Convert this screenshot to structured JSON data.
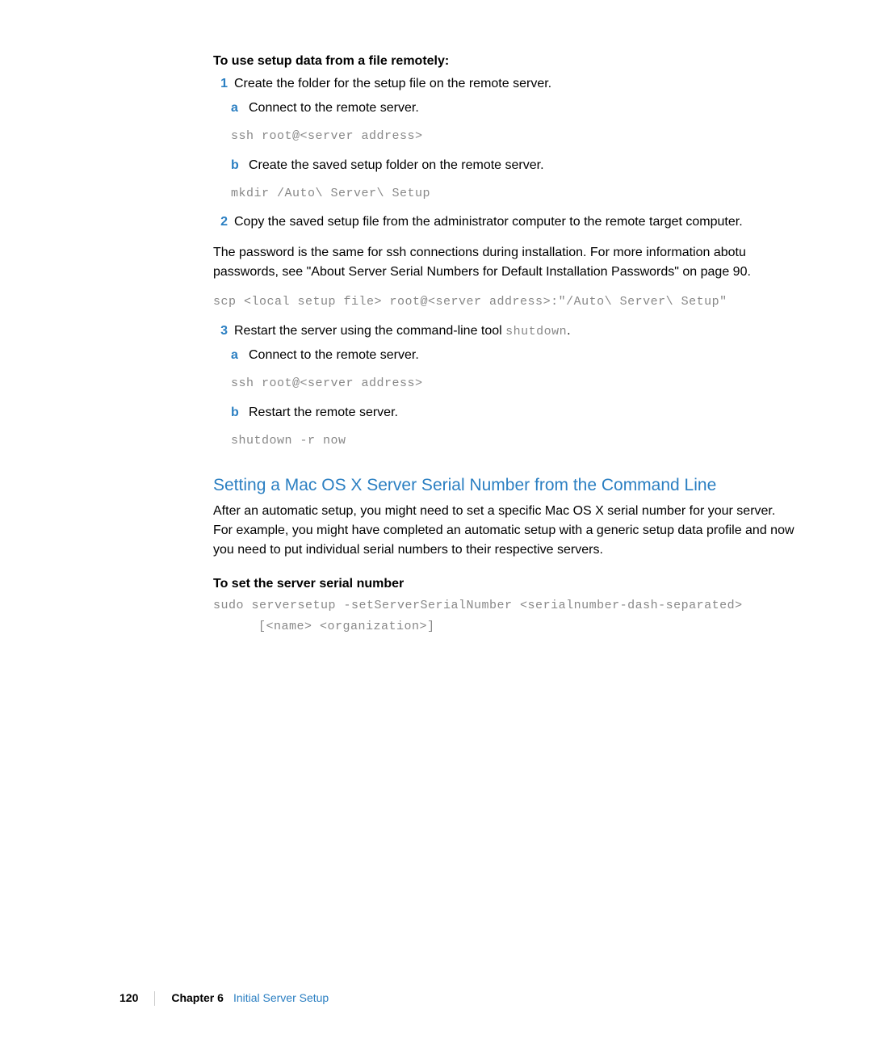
{
  "headings": {
    "remote_setup": "To use setup data from a file remotely:",
    "serial_section": "Setting a Mac OS X Server Serial Number from the Command Line",
    "serial_subheading": "To set the server serial number"
  },
  "steps": {
    "s1": {
      "num": "1",
      "text": "Create the folder for the setup file on the remote server.",
      "a": {
        "letter": "a",
        "text": "Connect to the remote server."
      },
      "a_code": "ssh root@<server address>",
      "b": {
        "letter": "b",
        "text": "Create the saved setup folder on the remote server."
      },
      "b_code": "mkdir /Auto\\ Server\\ Setup"
    },
    "s2": {
      "num": "2",
      "text": "Copy the saved setup file from the administrator computer to the remote target computer.",
      "para": "The password is the same for ssh connections during installation. For more information abotu passwords, see \"About Server Serial Numbers for Default Installation Passwords\" on page 90.",
      "code": "scp <local setup file> root@<server address>:\"/Auto\\ Server\\ Setup\""
    },
    "s3": {
      "num": "3",
      "text_before": "Restart the server using the command-line tool ",
      "code_inline": "shutdown",
      "text_after": ".",
      "a": {
        "letter": "a",
        "text": "Connect to the remote server."
      },
      "a_code": "ssh root@<server address>",
      "b": {
        "letter": "b",
        "text": "Restart the remote server."
      },
      "b_code": "shutdown -r now"
    }
  },
  "serial_section": {
    "para": "After an automatic setup, you might need to set a specific Mac OS X serial number for your server. For example, you might have completed an automatic setup with a generic setup data profile and now you need to put individual serial numbers to their respective servers.",
    "code_line1": "sudo serversetup -setServerSerialNumber <serialnumber-dash-separated>",
    "code_line2": "[<name> <organization>]"
  },
  "footer": {
    "page": "120",
    "chapter": "Chapter 6",
    "title": "Initial Server Setup"
  }
}
